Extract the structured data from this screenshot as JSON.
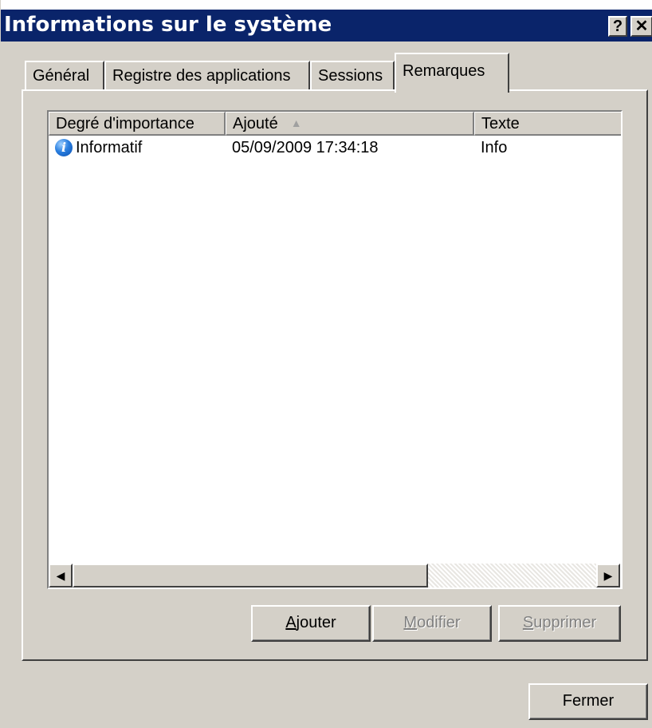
{
  "window": {
    "title": "Informations sur le système",
    "help_button": "?",
    "close_button": "✕"
  },
  "tabs": [
    {
      "label": "Général",
      "active": false
    },
    {
      "label": "Registre des applications",
      "active": false
    },
    {
      "label": "Sessions",
      "active": false
    },
    {
      "label": "Remarques",
      "active": true
    }
  ],
  "list": {
    "columns": [
      {
        "label": "Degré d'importance"
      },
      {
        "label": "Ajouté",
        "sort": "ascending"
      },
      {
        "label": "Texte"
      }
    ],
    "rows": [
      {
        "importance": "Informatif",
        "icon": "info-icon",
        "added": "05/09/2009 17:34:18",
        "text": "Info"
      }
    ],
    "sort_arrow": "▲",
    "scroll_left": "◀",
    "scroll_right": "▶"
  },
  "buttons": {
    "add_accel": "A",
    "add_rest": "jouter",
    "modify_accel": "M",
    "modify_rest": "odifier",
    "delete_accel": "S",
    "delete_rest": "upprimer",
    "close": "Fermer"
  },
  "colors": {
    "titlebar": "#0a246a",
    "face": "#d4d0c8",
    "disabled_text": "#808080"
  }
}
